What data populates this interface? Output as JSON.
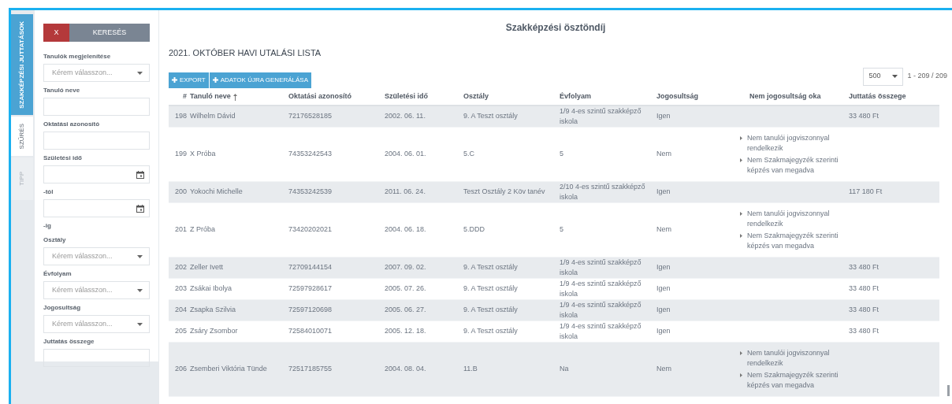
{
  "side_tabs": [
    {
      "label": "SZAKKÉPZÉSI JUTTATÁSOK",
      "kind": "title"
    },
    {
      "label": "SZŰRÉS",
      "kind": "tab",
      "selected": true,
      "disabled": false
    },
    {
      "label": "TIPP",
      "kind": "tab",
      "selected": false,
      "disabled": true
    }
  ],
  "filter": {
    "clear_button": "X",
    "search_button": "KERESÉS",
    "items": [
      {
        "kind": "label",
        "text": "Tanulók megjelenítése"
      },
      {
        "kind": "select",
        "placeholder": "Kérem válasszon..."
      },
      {
        "kind": "label",
        "text": "Tanuló neve"
      },
      {
        "kind": "text"
      },
      {
        "kind": "label",
        "text": "Oktatási azonosító"
      },
      {
        "kind": "text"
      },
      {
        "kind": "label",
        "text": "Születési idő"
      },
      {
        "kind": "date"
      },
      {
        "kind": "label",
        "text": "-tól"
      },
      {
        "kind": "date"
      },
      {
        "kind": "label",
        "text": "-ig"
      },
      {
        "kind": "label",
        "text": "Osztály"
      },
      {
        "kind": "select",
        "placeholder": "Kérem válasszon..."
      },
      {
        "kind": "label",
        "text": "Évfolyam"
      },
      {
        "kind": "select",
        "placeholder": "Kérem válasszon..."
      },
      {
        "kind": "label",
        "text": "Jogosultság"
      },
      {
        "kind": "select",
        "placeholder": "Kérem válasszon..."
      },
      {
        "kind": "label",
        "text": "Juttatás összege"
      },
      {
        "kind": "text"
      }
    ]
  },
  "page_title": "Szakképzési ösztöndíj",
  "list_title": "2021. OKTÓBER HAVI UTALÁSI LISTA",
  "toolbar": [
    "EXPORT",
    "ADATOK ÚJRA GENERÁLÁSA"
  ],
  "pagination": {
    "page_size": "500",
    "range": "1 - 209 / 209"
  },
  "table": {
    "columns": [
      {
        "label": "#",
        "sorted": false
      },
      {
        "label": "Tanuló neve",
        "sorted": true
      },
      {
        "label": "Oktatási azonosító",
        "sorted": false
      },
      {
        "label": "Születési idő",
        "sorted": false
      },
      {
        "label": "Osztály",
        "sorted": false
      },
      {
        "label": "Évfolyam",
        "sorted": false
      },
      {
        "label": "Jogosultság",
        "sorted": false
      },
      {
        "label": "Nem jogosultság oka",
        "sorted": false
      },
      {
        "label": "Juttatás összege",
        "sorted": false
      }
    ],
    "rows": [
      {
        "num": "198",
        "name": "Wilhelm Dávid",
        "id": "72176528185",
        "birth": "2002. 06. 11.",
        "class": "9. A Teszt osztály",
        "grade": "1/9 4-es szintű szakképző iskola",
        "eligible": "Igen",
        "reasons": [],
        "amount": "33 480 Ft"
      },
      {
        "num": "199",
        "name": "X Próba",
        "id": "74353242543",
        "birth": "2004. 06. 01.",
        "class": "5.C",
        "grade": "5",
        "eligible": "Nem",
        "reasons": [
          "Nem tanulói jogviszonnyal rendelkezik",
          "Nem Szakmajegyzék szerinti képzés van megadva"
        ],
        "amount": ""
      },
      {
        "num": "200",
        "name": "Yokochi Michelle",
        "id": "74353242539",
        "birth": "2011. 06. 24.",
        "class": "Teszt Osztály 2 Köv tanév",
        "grade": "2/10 4-es szintű szakképző iskola",
        "eligible": "Igen",
        "reasons": [],
        "amount": "117 180 Ft"
      },
      {
        "num": "201",
        "name": "Z Próba",
        "id": "73420202021",
        "birth": "2004. 06. 18.",
        "class": "5.DDD",
        "grade": "5",
        "eligible": "Nem",
        "reasons": [
          "Nem tanulói jogviszonnyal rendelkezik",
          "Nem Szakmajegyzék szerinti képzés van megadva"
        ],
        "amount": ""
      },
      {
        "num": "202",
        "name": "Zeller Ivett",
        "id": "72709144154",
        "birth": "2007. 09. 02.",
        "class": "9. A Teszt osztály",
        "grade": "1/9 4-es szintű szakképző iskola",
        "eligible": "Igen",
        "reasons": [],
        "amount": "33 480 Ft"
      },
      {
        "num": "203",
        "name": "Zsákai Ibolya",
        "id": "72597928617",
        "birth": "2005. 07. 26.",
        "class": "9. A Teszt osztály",
        "grade": "1/9 4-es szintű szakképző iskola",
        "eligible": "Igen",
        "reasons": [],
        "amount": "33 480 Ft"
      },
      {
        "num": "204",
        "name": "Zsapka Szilvia",
        "id": "72597120698",
        "birth": "2005. 06. 27.",
        "class": "9. A Teszt osztály",
        "grade": "1/9 4-es szintű szakképző iskola",
        "eligible": "Igen",
        "reasons": [],
        "amount": "33 480 Ft"
      },
      {
        "num": "205",
        "name": "Zsáry Zsombor",
        "id": "72584010071",
        "birth": "2005. 12. 18.",
        "class": "9. A Teszt osztály",
        "grade": "1/9 4-es szintű szakképző iskola",
        "eligible": "Igen",
        "reasons": [],
        "amount": "33 480 Ft"
      },
      {
        "num": "206",
        "name": "Zsemberi Viktória Tünde",
        "id": "72517185755",
        "birth": "2004. 08. 04.",
        "class": "11.B",
        "grade": "Na",
        "eligible": "Nem",
        "reasons": [
          "Nem tanulói jogviszonnyal rendelkezik",
          "Nem Szakmajegyzék szerinti képzés van megadva"
        ],
        "amount": ""
      }
    ]
  }
}
